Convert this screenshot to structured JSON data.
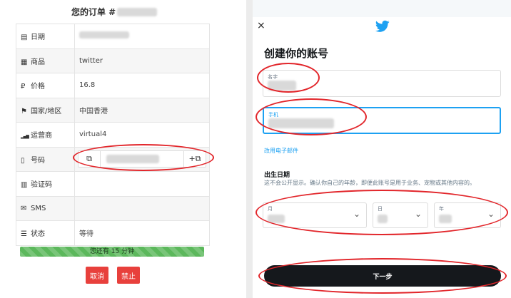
{
  "order": {
    "title": "您的订单 #",
    "rows": [
      {
        "icon": "▤",
        "icon_name": "calendar-icon",
        "label": "日期",
        "value": ""
      },
      {
        "icon": "▦",
        "icon_name": "product-icon",
        "label": "商品",
        "value": "twitter"
      },
      {
        "icon": "₽",
        "icon_name": "ruble-icon",
        "label": "价格",
        "value": "16.8"
      },
      {
        "icon": "⚑",
        "icon_name": "flag-icon",
        "label": "国家/地区",
        "value": "中国香港"
      },
      {
        "icon": "▂▄▆",
        "icon_name": "signal-icon",
        "label": "运营商",
        "value": "virtual4"
      },
      {
        "icon": "▯",
        "icon_name": "phone-icon",
        "label": "号码",
        "value": ""
      },
      {
        "icon": "▥",
        "icon_name": "barcode-icon",
        "label": "验证码",
        "value": ""
      },
      {
        "icon": "✉",
        "icon_name": "envelope-icon",
        "label": "SMS",
        "value": ""
      },
      {
        "icon": "☰",
        "icon_name": "list-icon",
        "label": "状态",
        "value": "等待"
      }
    ],
    "copy_icon": "⧉",
    "copy_plus_icon": "+⧉",
    "progress_text": "您还有 15 分钟",
    "progress_fraction": 1.0,
    "progress_color": "#5cb85c",
    "cancel_label": "取消",
    "ban_label": "禁止",
    "button_color": "#e8403c"
  },
  "signup": {
    "close_icon": "×",
    "title": "创建你的账号",
    "name_label": "名字",
    "phone_label": "手机",
    "use_email_link": "改用电子邮件",
    "dob_label": "出生日期",
    "dob_description": "这不会公开显示。确认你自己的年龄，即便此账号是用于业务、宠物或其他内容的。",
    "month_label": "月",
    "day_label": "日",
    "year_label": "年",
    "chevron": "⌄",
    "next_label": "下一步",
    "brand_color": "#1da1f2"
  },
  "annotation_color": "#e2262b"
}
